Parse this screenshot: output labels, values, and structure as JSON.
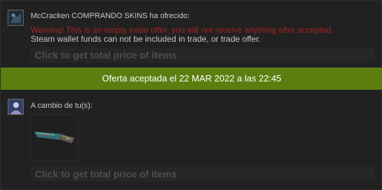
{
  "offer": {
    "sender_header": "McCracken COMPRANDO SKINS ha ofrecido:",
    "warning": "Warning! This is an empty trade offer, you will not receive anything after accepted.",
    "steam_note": "Steam wallet funds can not be included in trade, or trade offer.",
    "price_label_top": "Click to get total price of items",
    "status_banner": "Oferta aceptada el 22 MAR 2022 a las 22:45",
    "return_header": "A cambio de tu(s):",
    "price_label_bottom": "Click to get total price of items",
    "item_icon": "knife-skin-icon"
  },
  "colors": {
    "banner": "#5c7e10",
    "warning": "#a3231d",
    "background": "#212121"
  }
}
